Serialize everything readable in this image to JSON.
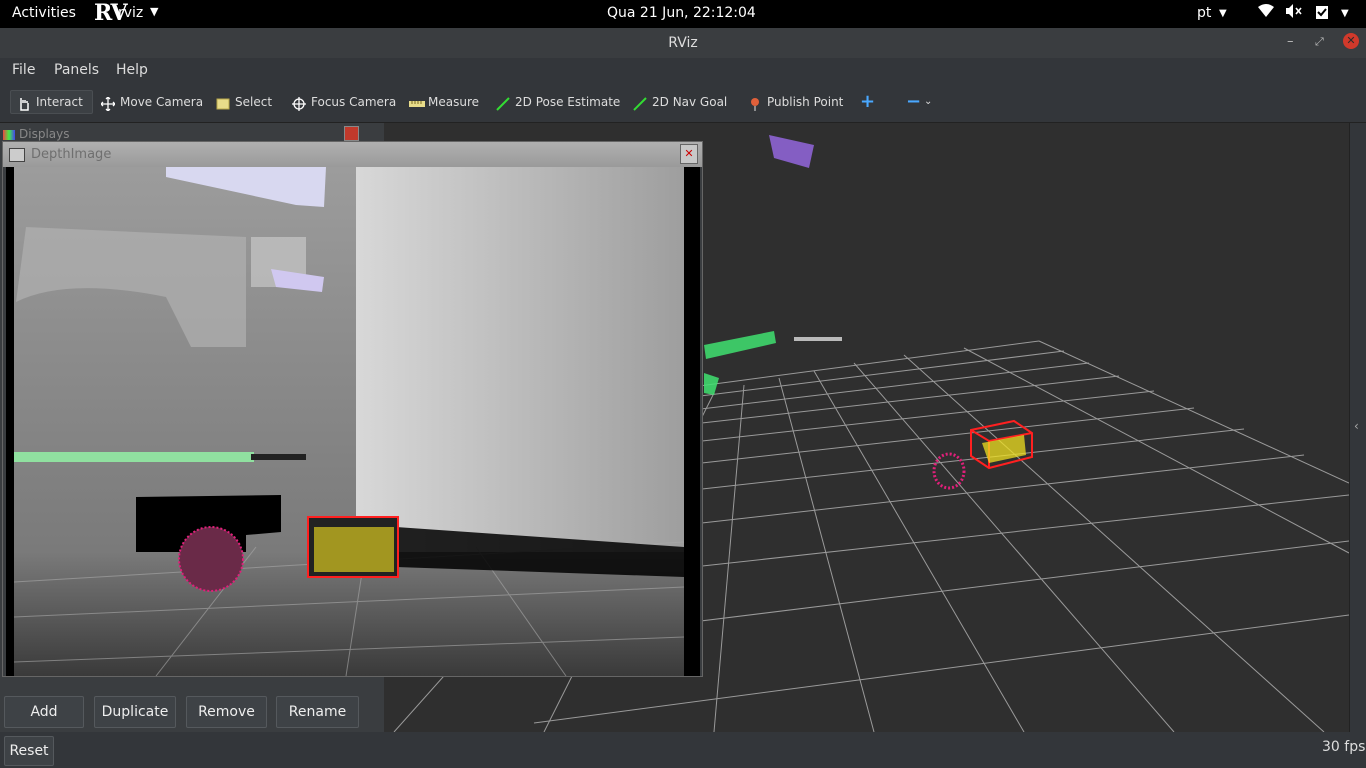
{
  "topbar": {
    "activities": "Activities",
    "app_logo": "RViz",
    "app_name": "rviz",
    "datetime": "Qua 21 Jun, 22:12:04",
    "language": "pt"
  },
  "window": {
    "title": "RViz"
  },
  "menu": {
    "file": "File",
    "panels": "Panels",
    "help": "Help"
  },
  "toolbar": {
    "interact": "Interact",
    "move_camera": "Move Camera",
    "select": "Select",
    "focus_camera": "Focus Camera",
    "measure": "Measure",
    "pose_estimate": "2D Pose Estimate",
    "nav_goal": "2D Nav Goal",
    "publish_point": "Publish Point",
    "add_tool": "+",
    "remove_tool": "−"
  },
  "displays_panel": {
    "title": "Displays",
    "buttons": {
      "add": "Add",
      "duplicate": "Duplicate",
      "remove": "Remove",
      "rename": "Rename"
    }
  },
  "depth_panel": {
    "title": "DepthImage"
  },
  "statusbar": {
    "reset": "Reset",
    "fps": "30 fps"
  },
  "colors": {
    "window_bg": "#3a3d40",
    "viewport_bg": "#2f2f2f",
    "grid": "#a0a0a0",
    "bbox": "#ff2020",
    "points_yellow": "#f0e020",
    "points_magenta": "#e0207a",
    "points_green": "#40e070",
    "points_purple": "#9a6ae8"
  }
}
